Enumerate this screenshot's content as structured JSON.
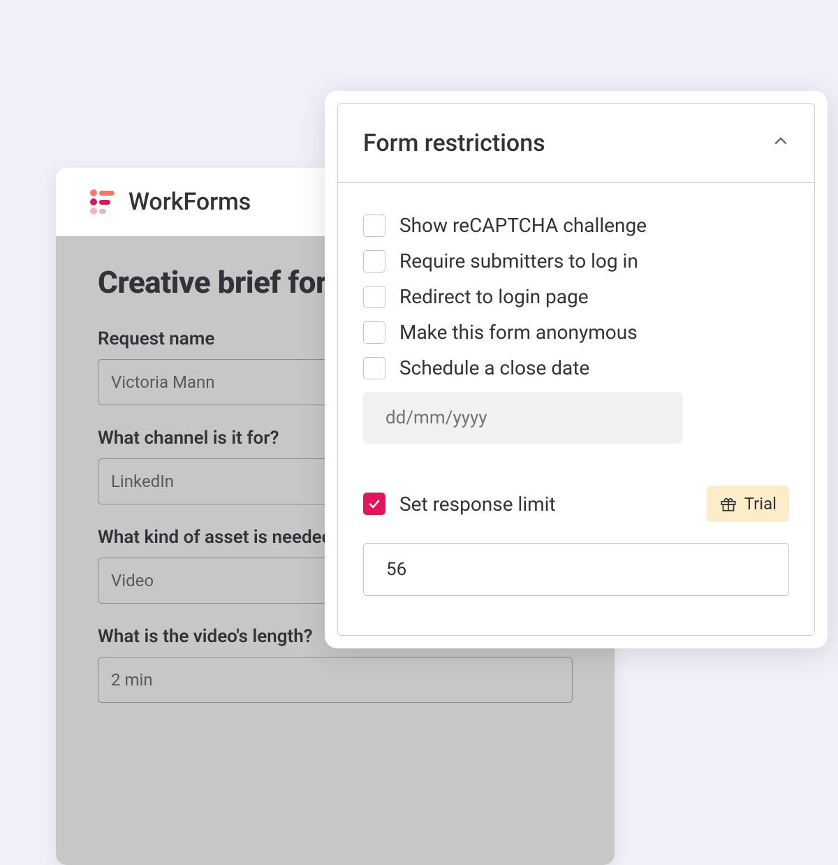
{
  "brand": "WorkForms",
  "form": {
    "title": "Creative brief form",
    "fields": [
      {
        "label": "Request name",
        "value": "Victoria Mann"
      },
      {
        "label": "What channel is it for?",
        "value": "LinkedIn"
      },
      {
        "label": "What kind of asset is needed?",
        "value": "Video"
      },
      {
        "label": "What is the video's length?",
        "value": "2 min"
      }
    ]
  },
  "settings": {
    "section_title": "Form restrictions",
    "options": {
      "recaptcha": {
        "label": "Show reCAPTCHA challenge",
        "checked": false
      },
      "require_login": {
        "label": "Require submitters to log in",
        "checked": false
      },
      "redirect_login": {
        "label": "Redirect to login page",
        "checked": false
      },
      "anonymous": {
        "label": "Make this form anonymous",
        "checked": false
      },
      "close_date": {
        "label": "Schedule a close date",
        "checked": false,
        "placeholder": "dd/mm/yyyy"
      },
      "response_limit": {
        "label": "Set response limit",
        "checked": true,
        "value": "56"
      }
    },
    "trial_label": "Trial"
  }
}
